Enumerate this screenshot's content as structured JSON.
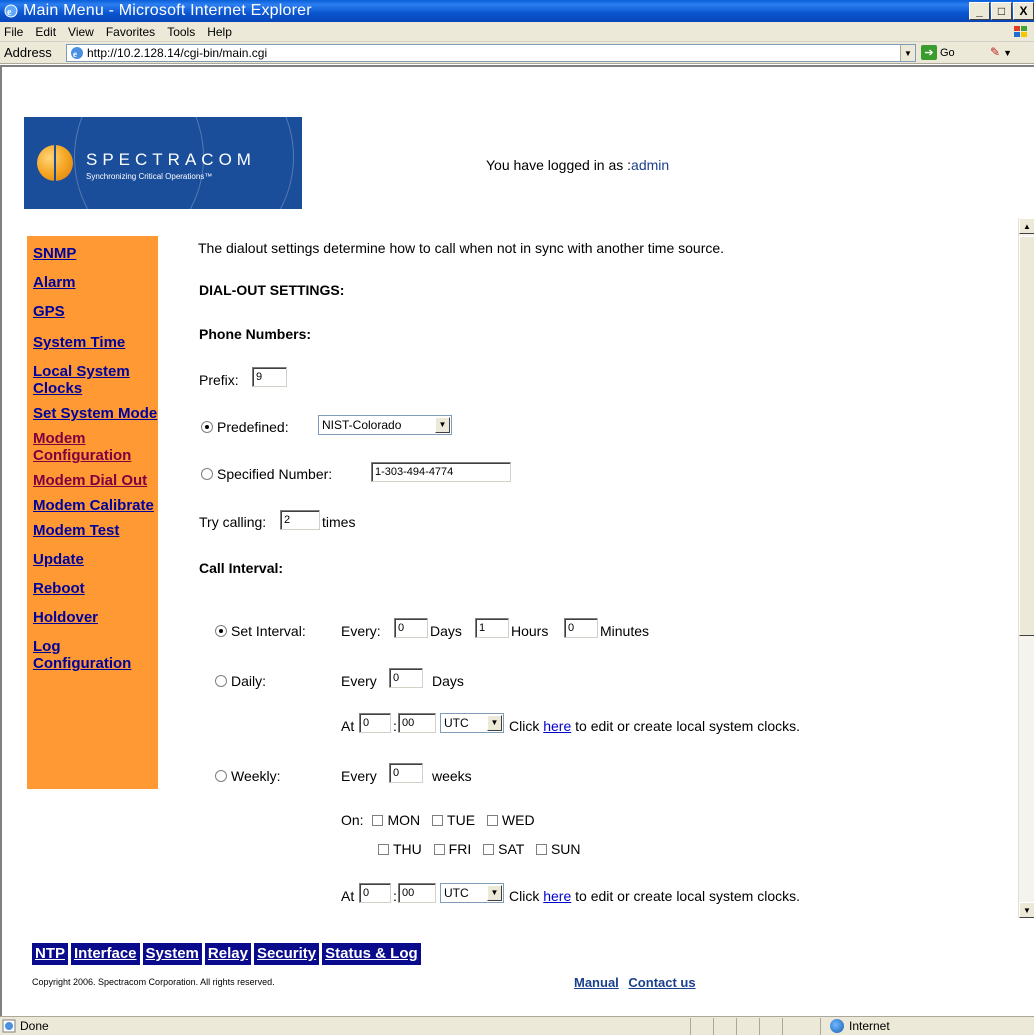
{
  "window": {
    "title": "Main Menu - Microsoft Internet Explorer",
    "min": "_",
    "max": "□",
    "close": "X"
  },
  "menu": [
    "File",
    "Edit",
    "View",
    "Favorites",
    "Tools",
    "Help"
  ],
  "address": {
    "label": "Address",
    "url": "http://10.2.128.14/cgi-bin/main.cgi",
    "go_label": "Go"
  },
  "header": {
    "brand": "SPECTRACOM",
    "tagline": "Synchronizing Critical Operations™",
    "logged_prefix": "You have logged in as :",
    "logged_user": "admin"
  },
  "sidebar": {
    "items": [
      {
        "label": "SNMP",
        "visited": false
      },
      {
        "label": "Alarm",
        "visited": false
      },
      {
        "label": "GPS",
        "visited": false
      },
      {
        "label": "System Time",
        "visited": false
      },
      {
        "label": "Local System Clocks",
        "visited": false
      },
      {
        "label": "Set System Mode",
        "visited": false
      },
      {
        "label": "Modem Configuration",
        "visited": true
      },
      {
        "label": "Modem Dial Out",
        "visited": true
      },
      {
        "label": "Modem Calibrate",
        "visited": false
      },
      {
        "label": "Modem Test",
        "visited": false
      },
      {
        "label": "Update",
        "visited": false
      },
      {
        "label": "Reboot",
        "visited": false
      },
      {
        "label": "Holdover",
        "visited": false
      },
      {
        "label": "Log Configuration",
        "visited": false
      }
    ]
  },
  "content": {
    "intro": "The dialout settings determine how to call when not in sync with another time source.",
    "section_title": "DIAL-OUT SETTINGS:",
    "phone_title": "Phone Numbers:",
    "prefix_label": "Prefix:",
    "prefix_value": "9",
    "predefined_label": "Predefined:",
    "predefined_value": "NIST-Colorado",
    "predefined_selected": true,
    "specified_label": "Specified Number:",
    "specified_value": "1-303-494-4774",
    "try_label": "Try calling:",
    "try_value": "2",
    "try_suffix": "times",
    "interval_title": "Call Interval:",
    "set_interval": {
      "label": "Set Interval:",
      "selected": true,
      "every": "Every:",
      "days_value": "0",
      "days": "Days",
      "hours_value": "1",
      "hours": "Hours",
      "minutes_value": "0",
      "minutes": "Minutes"
    },
    "daily": {
      "label": "Daily:",
      "selected": false,
      "every": "Every",
      "days_value": "0",
      "days": "Days",
      "at": "At",
      "hour_value": "0",
      "colon": ":",
      "min_value": "00",
      "tz": "UTC",
      "click": "Click",
      "here": "here",
      "rest": "to edit or create local system clocks."
    },
    "weekly": {
      "label": "Weekly:",
      "selected": false,
      "every": "Every",
      "weeks_value": "0",
      "weeks": "weeks",
      "on": "On:",
      "days_row1": [
        "MON",
        "TUE",
        "WED"
      ],
      "days_row2": [
        "THU",
        "FRI",
        "SAT",
        "SUN"
      ],
      "at": "At",
      "hour_value": "0",
      "colon": ":",
      "min_value": "00",
      "tz": "UTC",
      "click": "Click",
      "here": "here",
      "rest": "to edit or create local system clocks."
    }
  },
  "footer": {
    "nav": [
      "NTP",
      "Interface",
      "System",
      "Relay",
      "Security",
      "Status & Log"
    ],
    "copyright": "Copyright 2006. Spectracom Corporation. All rights reserved.",
    "manual": "Manual",
    "contact": "Contact us"
  },
  "status": {
    "done": "Done",
    "zone": "Internet"
  }
}
